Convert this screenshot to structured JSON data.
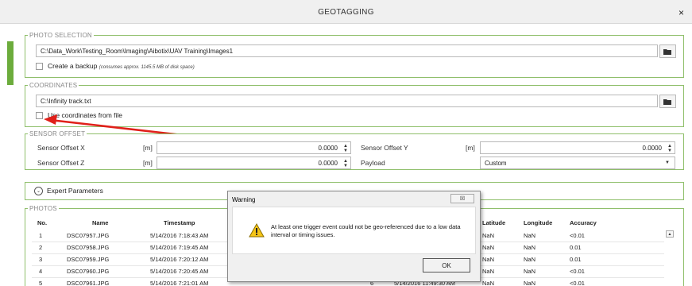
{
  "window": {
    "title": "GEOTAGGING",
    "close_glyph": "×"
  },
  "photo_selection": {
    "label": "PHOTO SELECTION",
    "path": "C:\\Data_Work\\Testing_Room\\Imaging\\Aibotix\\UAV Training\\Images1",
    "backup_label": "Create a backup",
    "backup_note": "(consumes approx. 1145.5 MB of disk space)"
  },
  "coordinates": {
    "label": "COORDINATES",
    "path": "C:\\Infinity track.txt",
    "use_label": "Use coordinates from file"
  },
  "sensor_offset": {
    "label": "SENSOR OFFSET",
    "x_label": "Sensor Offset X",
    "x_unit": "[m]",
    "x_value": "0.0000",
    "y_label": "Sensor Offset Y",
    "y_unit": "[m]",
    "y_value": "0.0000",
    "z_label": "Sensor Offset Z",
    "z_unit": "[m]",
    "z_value": "0.0000",
    "payload_label": "Payload",
    "payload_value": "Custom"
  },
  "expert": {
    "label": "Expert Parameters"
  },
  "photos": {
    "label": "PHOTOS",
    "headers": {
      "no": "No.",
      "name": "Name",
      "timestamp": "Timestamp",
      "latitude": "Latitude",
      "longitude": "Longitude",
      "accuracy": "Accuracy"
    },
    "rows": [
      {
        "no": "1",
        "name": "DSC07957.JPG",
        "timestamp": "5/14/2016 7:18:43 AM",
        "latitude": "NaN",
        "longitude": "NaN",
        "accuracy": "<0.01"
      },
      {
        "no": "2",
        "name": "DSC07958.JPG",
        "timestamp": "5/14/2016 7:19:45 AM",
        "latitude": "NaN",
        "longitude": "NaN",
        "accuracy": "0.01"
      },
      {
        "no": "3",
        "name": "DSC07959.JPG",
        "timestamp": "5/14/2016 7:20:12 AM",
        "latitude": "NaN",
        "longitude": "NaN",
        "accuracy": "0.01"
      },
      {
        "no": "4",
        "name": "DSC07960.JPG",
        "timestamp": "5/14/2016 7:20:45 AM",
        "latitude": "NaN",
        "longitude": "NaN",
        "accuracy": "<0.01"
      },
      {
        "no": "5",
        "name": "DSC07961.JPG",
        "timestamp": "5/14/2016 7:21:01 AM",
        "latitude": "NaN",
        "longitude": "NaN",
        "accuracy": "<0.01"
      }
    ],
    "partial_row": {
      "no": "6",
      "timestamp": "5/14/2016 11:49:30 AM"
    }
  },
  "dialog": {
    "title": "Warning",
    "close_glyph": "☒",
    "message": "At least one trigger event could not be geo-referenced due to a low data interval or timing issues.",
    "ok_label": "OK"
  },
  "colors": {
    "accent": "#6cac3c",
    "group_border": "#8fbf6b",
    "arrow": "#e0201a"
  },
  "icons": {
    "folder": "folder-icon",
    "warning": "warning-icon",
    "expand": "chevron-down-icon",
    "spin": "spinner-icon"
  }
}
